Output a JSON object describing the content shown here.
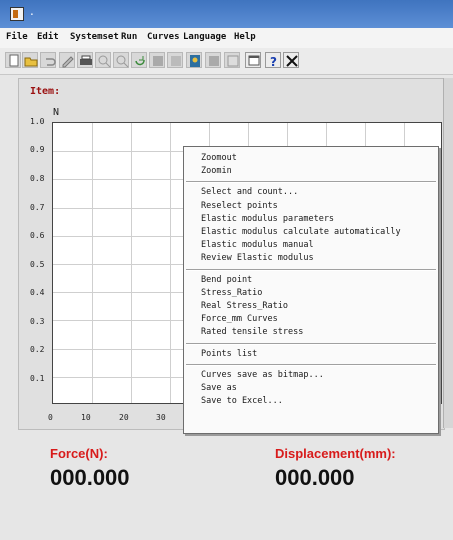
{
  "window": {
    "title": "."
  },
  "menu": [
    "File",
    "Edit",
    "Systemset",
    "Run",
    "Curves",
    "Language",
    "Help"
  ],
  "toolbar": {
    "buttons": [
      "new-file-icon",
      "open-folder-icon",
      "undo-icon",
      "edit-icon",
      "print-icon",
      "zoom-in-icon",
      "zoom-out-icon",
      "refresh-icon",
      "stop-icon",
      "grid-icon",
      "user-icon",
      "chart-icon",
      "table-icon",
      "window-icon",
      "help-icon",
      "close-icon"
    ]
  },
  "panel": {
    "item_label": "Item:"
  },
  "chart_data": {
    "type": "line",
    "y_unit": "N",
    "ylim": [
      0,
      1.0
    ],
    "y_ticks": [
      "1.0",
      "0.9",
      "0.8",
      "0.7",
      "0.6",
      "0.5",
      "0.4",
      "0.3",
      "0.2",
      "0.1"
    ],
    "x_ticks": [
      "0",
      "10",
      "20",
      "30"
    ],
    "grid": true,
    "series": []
  },
  "context_menu": {
    "groups": [
      [
        "Zoomout",
        "Zoomin"
      ],
      [
        "Select and count...",
        "Reselect points",
        "Elastic modulus parameters",
        "Elastic modulus calculate automatically",
        "Elastic modulus manual",
        "Review Elastic modulus"
      ],
      [
        "Bend point",
        "Stress_Ratio",
        "Real Stress_Ratio",
        "Force_mm Curves",
        "Rated tensile stress"
      ],
      [
        "Points list"
      ],
      [
        "Curves save as bitmap...",
        "Save as",
        "Save to Excel..."
      ]
    ]
  },
  "readouts": {
    "force_label": "Force(N):",
    "force_value": "000.000",
    "displacement_label": "Displacement(mm):",
    "displacement_value": "000.000"
  },
  "colors": {
    "titlebar": "#4a7ec9",
    "readout_label": "#d81b1b",
    "item_label": "#9a1010"
  }
}
